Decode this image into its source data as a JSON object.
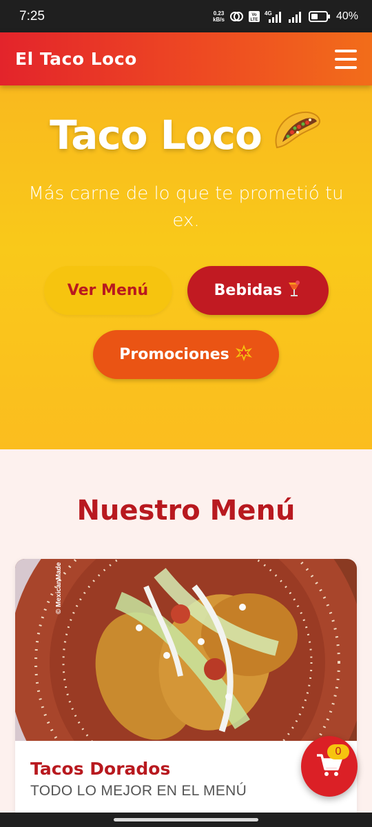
{
  "status_bar": {
    "time": "7:25",
    "net_speed_value": "0.23",
    "net_speed_unit": "kB/s",
    "network_type": "4G",
    "volte_label": "Vo LTE",
    "battery_percent": "40%",
    "icons": [
      "hotspot-icon",
      "volte-icon",
      "signal-icon",
      "signal-icon",
      "battery-icon"
    ]
  },
  "header": {
    "brand": "El Taco Loco",
    "menu_icon": "hamburger-icon"
  },
  "hero": {
    "title": "Taco Loco",
    "title_emoji": "taco-emoji",
    "subtitle": "Más carne de lo que te prometió tu ex.",
    "buttons": {
      "menu": "Ver Menú",
      "bebidas": "Bebidas",
      "bebidas_emoji": "tropical-drink-emoji",
      "promociones": "Promociones",
      "promociones_emoji": "collision-emoji"
    },
    "colors": {
      "background": "#f9c91a",
      "menu_button": "#f6c40f",
      "bebidas_button": "#c11a22",
      "promo_button": "#ea5414"
    }
  },
  "menu_section": {
    "title": "Nuestro Menú",
    "items": [
      {
        "title": "Tacos Dorados",
        "subtitle": "TODO LO MEJOR EN EL MENÚ",
        "image": "tacos-dorados-photo",
        "watermark": "© MexicanMade"
      }
    ]
  },
  "cart": {
    "count": "0",
    "icon": "cart-icon"
  },
  "brand_colors": {
    "red": "#b8191f",
    "header_start": "#e3242b",
    "header_end": "#f26d1a"
  }
}
